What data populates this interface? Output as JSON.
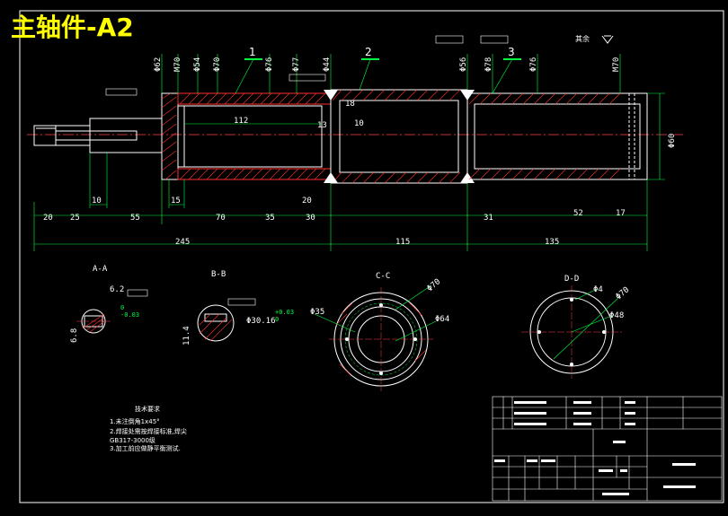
{
  "title": "主轴件-A2",
  "corner_mark": "其余",
  "callouts": [
    "1",
    "2",
    "3"
  ],
  "diameters_top": [
    "Φ62",
    "M70",
    "Φ54",
    "Φ70",
    "Φ76",
    "Φ77",
    "Φ44",
    "Φ56",
    "Φ78",
    "Φ76",
    "M70"
  ],
  "diameter_right": "Φ60",
  "inner_dims": [
    "112",
    "13",
    "18",
    "10"
  ],
  "bottom_dims_row1": [
    "20",
    "25",
    "55",
    "10",
    "15",
    "70",
    "35",
    "30",
    "20",
    "31",
    "52",
    "17"
  ],
  "bottom_dims_row2": [
    "245",
    "115",
    "135"
  ],
  "sections": {
    "aa": {
      "label": "A-A",
      "width": "6.2",
      "tol": "0\n-0.03",
      "depth": "6.8"
    },
    "bb": {
      "label": "B-B",
      "dia": "Φ30.16",
      "tol": "+0.03\n0",
      "depth": "11.4"
    },
    "cc": {
      "label": "C-C",
      "d1": "Φ70",
      "d2": "Φ35",
      "d3": "Φ64"
    },
    "dd": {
      "label": "D-D",
      "d1": "Φ4",
      "d2": "Φ70",
      "d3": "Φ48"
    }
  },
  "notes": {
    "heading": "技术要求",
    "lines": [
      "1.未注倒角1x45°",
      "2.焊接处需按焊接标准,焊尖",
      "GB317-3000级",
      "3.加工前应做静平衡测试."
    ]
  }
}
